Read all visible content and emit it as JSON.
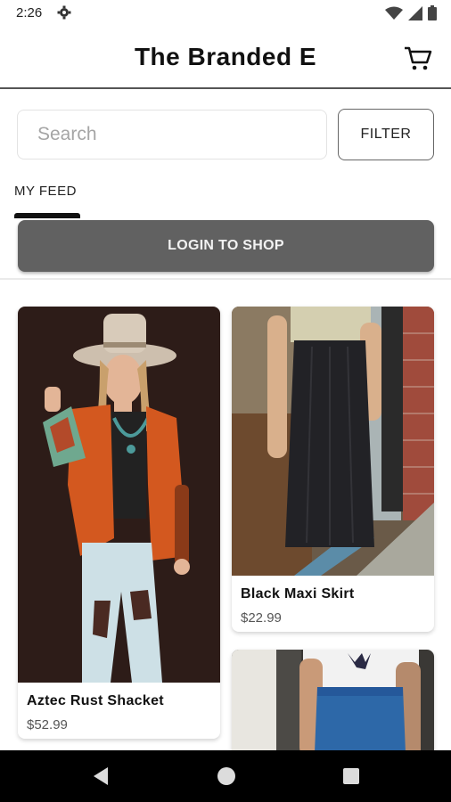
{
  "status_bar": {
    "time": "2:26"
  },
  "app_bar": {
    "title": "The Branded E"
  },
  "search": {
    "placeholder": "Search"
  },
  "filter_label": "FILTER",
  "feed_tab": "MY FEED",
  "login_label": "LOGIN TO SHOP",
  "products": [
    {
      "name": "Aztec Rust Shacket",
      "price": "$52.99"
    },
    {
      "name": "Black Maxi Skirt",
      "price": "$22.99"
    }
  ],
  "colors": {
    "login_button": "#616161",
    "nav_bar": "#000000"
  }
}
